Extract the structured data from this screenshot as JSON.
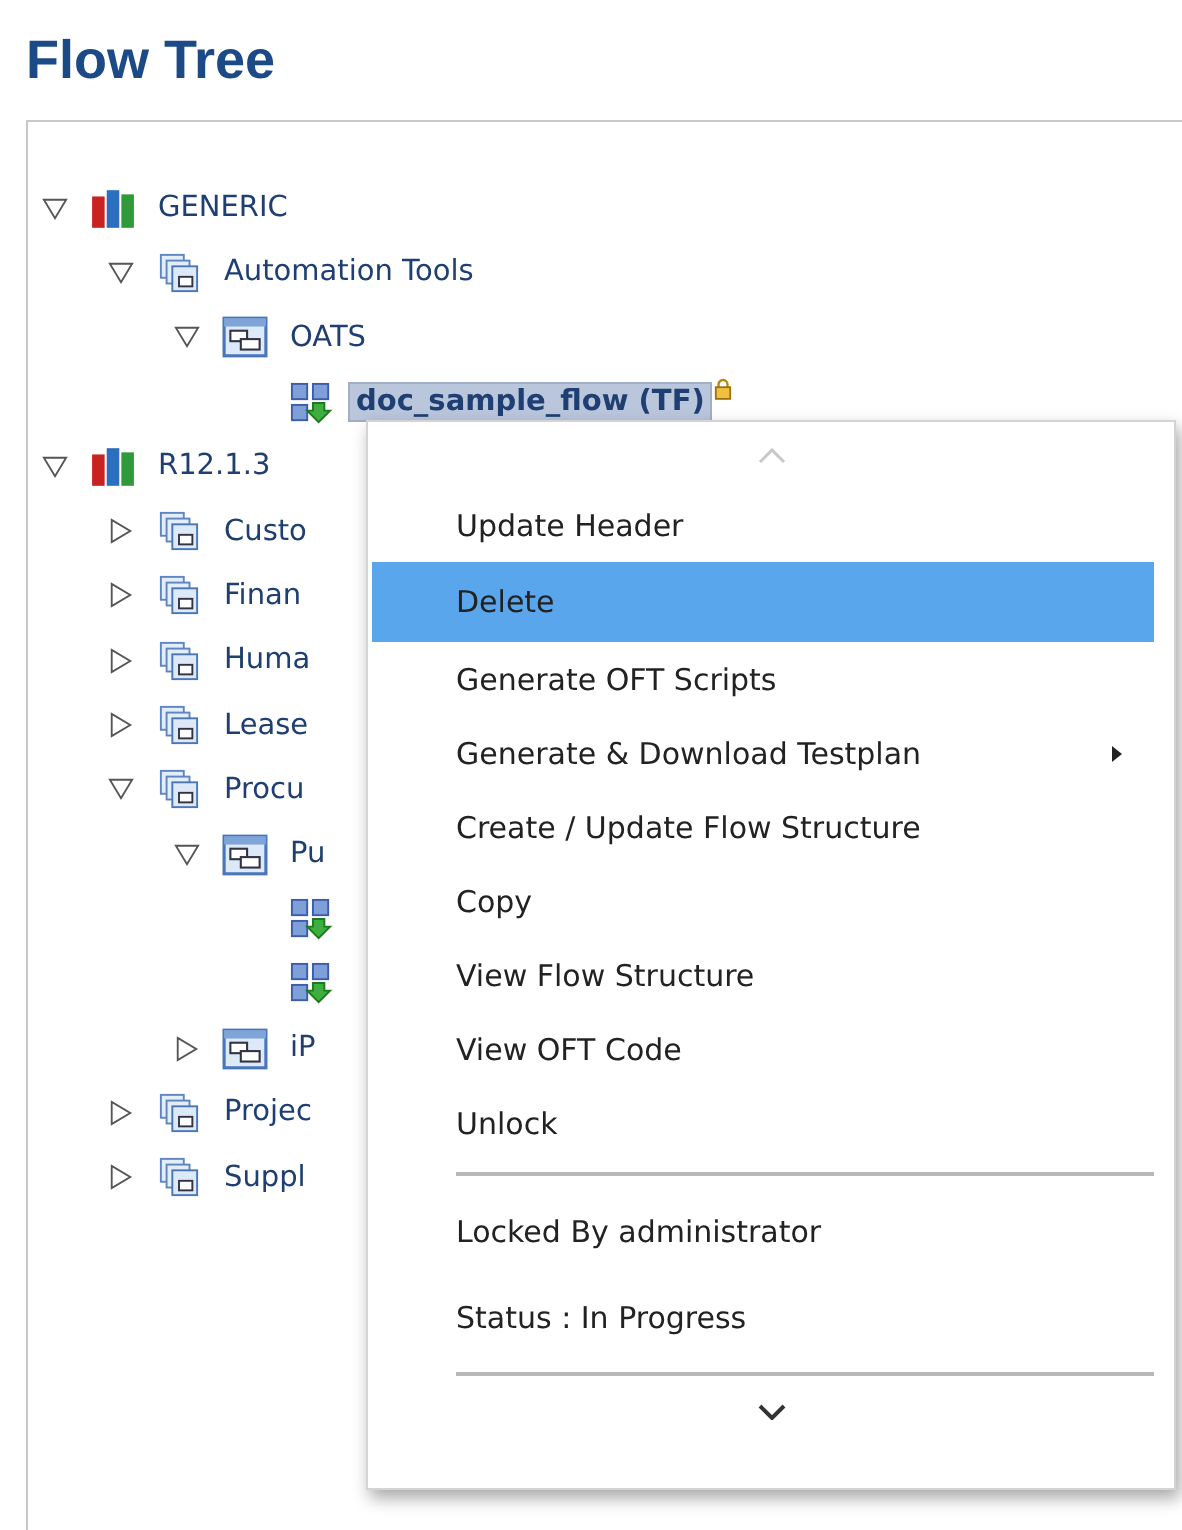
{
  "title": "Flow Tree",
  "tree": [
    {
      "kind": "root",
      "label": "GENERIC",
      "expanded": true,
      "children": [
        {
          "kind": "folder",
          "label": "Automation Tools",
          "expanded": true,
          "children": [
            {
              "kind": "group",
              "label": "OATS",
              "expanded": true,
              "children": [
                {
                  "kind": "flow",
                  "label": "doc_sample_flow (TF)",
                  "selected": true,
                  "locked": true
                }
              ]
            }
          ]
        }
      ]
    },
    {
      "kind": "root",
      "label": "R12.1.3",
      "expanded": true,
      "children": [
        {
          "kind": "folder",
          "label": "Custo",
          "expanded": false
        },
        {
          "kind": "folder",
          "label": "Finan",
          "expanded": false
        },
        {
          "kind": "folder",
          "label": "Huma",
          "expanded": false
        },
        {
          "kind": "folder",
          "label": "Lease",
          "expanded": false
        },
        {
          "kind": "folder",
          "label": "Procu",
          "expanded": true,
          "children": [
            {
              "kind": "group",
              "label": "Pu",
              "expanded": true,
              "children": [
                {
                  "kind": "flow"
                },
                {
                  "kind": "flow"
                }
              ]
            },
            {
              "kind": "group",
              "label": "iP",
              "expanded": false
            }
          ]
        },
        {
          "kind": "folder",
          "label": "Projec",
          "expanded": false
        },
        {
          "kind": "folder",
          "label": "Suppl",
          "expanded": false
        }
      ]
    }
  ],
  "context_menu": [
    {
      "kind": "action",
      "label": "Update Header",
      "selected": false
    },
    {
      "kind": "action",
      "label": "Delete",
      "selected": true
    },
    {
      "kind": "action",
      "label": "Generate OFT Scripts",
      "selected": false
    },
    {
      "kind": "submenu",
      "label": "Generate & Download Testplan",
      "selected": false
    },
    {
      "kind": "action",
      "label": "Create / Update Flow Structure",
      "selected": false
    },
    {
      "kind": "action",
      "label": "Copy",
      "selected": false
    },
    {
      "kind": "action",
      "label": "View Flow Structure",
      "selected": false
    },
    {
      "kind": "action",
      "label": "View OFT Code",
      "selected": false
    },
    {
      "kind": "action",
      "label": "Unlock",
      "selected": false
    },
    {
      "kind": "separator"
    },
    {
      "kind": "info",
      "label": "Locked By administrator"
    },
    {
      "kind": "info",
      "label": "Status : In Progress"
    },
    {
      "kind": "separator"
    }
  ]
}
